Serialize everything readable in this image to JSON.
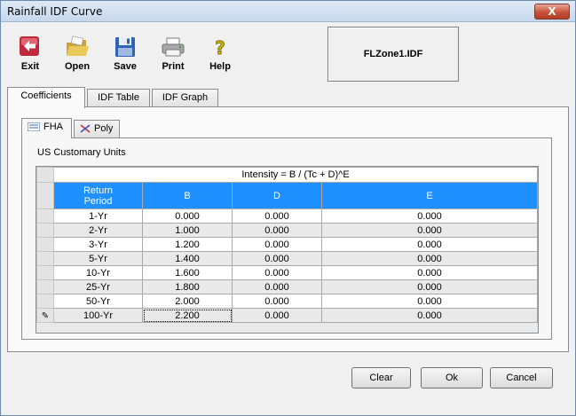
{
  "window": {
    "title": "Rainfall IDF Curve",
    "close_glyph": "X"
  },
  "toolbar": {
    "items": [
      {
        "label": "Exit",
        "icon": "exit-arrow-icon"
      },
      {
        "label": "Open",
        "icon": "folder-icon"
      },
      {
        "label": "Save",
        "icon": "floppy-disk-icon"
      },
      {
        "label": "Print",
        "icon": "printer-icon"
      },
      {
        "label": "Help",
        "icon": "help-question-icon"
      }
    ],
    "file_name": "FLZone1.IDF"
  },
  "tabs": [
    {
      "label": "Coefficients",
      "active": true
    },
    {
      "label": "IDF Table",
      "active": false
    },
    {
      "label": "IDF Graph",
      "active": false
    }
  ],
  "subtabs": [
    {
      "label": "FHA",
      "icon": "fha-icon",
      "active": true
    },
    {
      "label": "Poly",
      "icon": "poly-icon",
      "active": false
    }
  ],
  "units_label": "US Customary Units",
  "grid": {
    "formula": "Intensity = B / (Tc + D)^E",
    "columns": [
      "Return\nPeriod",
      "B",
      "D",
      "E"
    ],
    "rows": [
      {
        "period": "1-Yr",
        "b": "0.000",
        "d": "0.000",
        "e": "0.000"
      },
      {
        "period": "2-Yr",
        "b": "1.000",
        "d": "0.000",
        "e": "0.000"
      },
      {
        "period": "3-Yr",
        "b": "1.200",
        "d": "0.000",
        "e": "0.000"
      },
      {
        "period": "5-Yr",
        "b": "1.400",
        "d": "0.000",
        "e": "0.000"
      },
      {
        "period": "10-Yr",
        "b": "1.600",
        "d": "0.000",
        "e": "0.000"
      },
      {
        "period": "25-Yr",
        "b": "1.800",
        "d": "0.000",
        "e": "0.000"
      },
      {
        "period": "50-Yr",
        "b": "2.000",
        "d": "0.000",
        "e": "0.000"
      },
      {
        "period": "100-Yr",
        "b": "2.200",
        "d": "0.000",
        "e": "0.000"
      }
    ],
    "editing_row_indicator": "✎",
    "header_color": "#1e90ff"
  },
  "buttons": {
    "clear": "Clear",
    "ok": "Ok",
    "cancel": "Cancel"
  }
}
